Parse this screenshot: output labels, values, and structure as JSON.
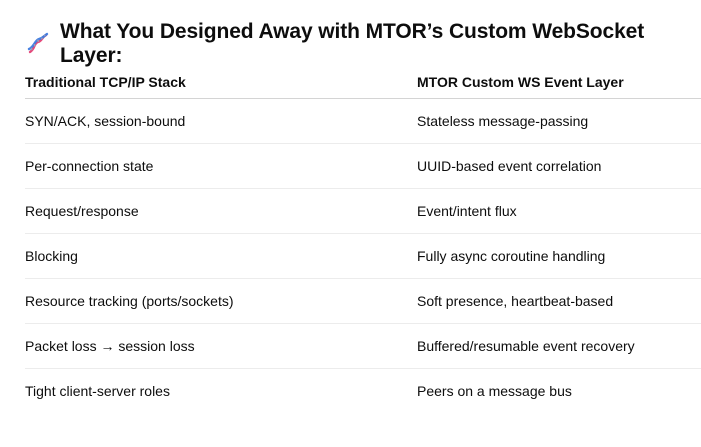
{
  "heading": {
    "icon": "dna-icon",
    "text": "What You Designed Away with MTOR’s Custom WebSocket Layer:"
  },
  "table": {
    "headers": [
      "Traditional TCP/IP Stack",
      "MTOR Custom WS Event Layer"
    ],
    "rows": [
      [
        "SYN/ACK, session-bound",
        "Stateless message-passing"
      ],
      [
        "Per-connection state",
        "UUID-based event correlation"
      ],
      [
        "Request/response",
        "Event/intent flux"
      ],
      [
        "Blocking",
        "Fully async coroutine handling"
      ],
      [
        "Resource tracking (ports/sockets)",
        "Soft presence, heartbeat-based"
      ],
      [
        "Packet loss → session loss",
        "Buffered/resumable event recovery"
      ],
      [
        "Tight client-server roles",
        "Peers on a message bus"
      ]
    ]
  }
}
